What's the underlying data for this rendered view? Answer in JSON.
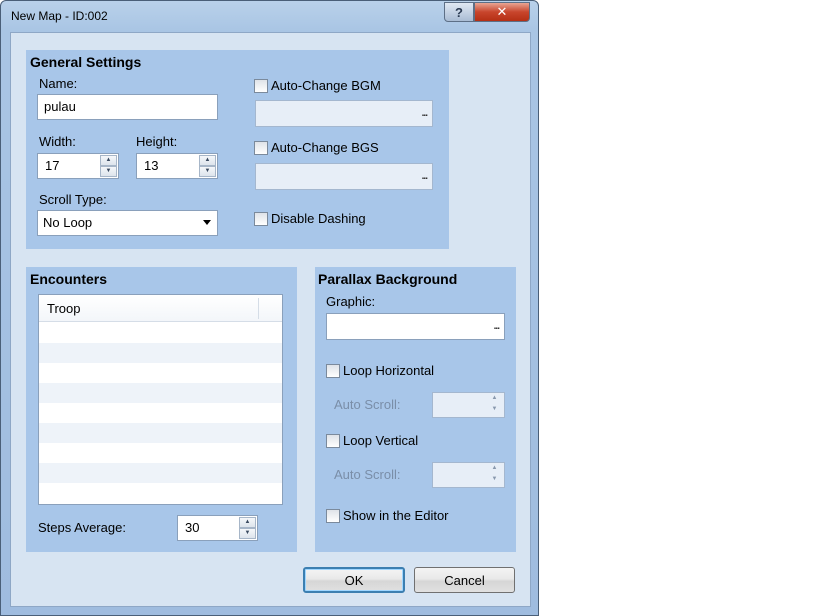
{
  "window": {
    "title": "New Map - ID:002",
    "help_glyph": "?",
    "close_glyph": "✕"
  },
  "general": {
    "title": "General Settings",
    "name_label": "Name:",
    "name_value": "pulau",
    "width_label": "Width:",
    "width_value": "17",
    "height_label": "Height:",
    "height_value": "13",
    "scroll_label": "Scroll Type:",
    "scroll_value": "No Loop",
    "bgm_label": "Auto-Change BGM",
    "bgs_label": "Auto-Change BGS",
    "dash_label": "Disable Dashing",
    "ellipsis": "..."
  },
  "encounters": {
    "title": "Encounters",
    "column": "Troop",
    "steps_label": "Steps Average:",
    "steps_value": "30"
  },
  "parallax": {
    "title": "Parallax Background",
    "graphic_label": "Graphic:",
    "ellipsis": "...",
    "loop_h_label": "Loop Horizontal",
    "auto_scroll_label_1": "Auto Scroll:",
    "loop_v_label": "Loop Vertical",
    "auto_scroll_label_2": "Auto Scroll:",
    "show_editor_label": "Show in the Editor"
  },
  "buttons": {
    "ok": "OK",
    "cancel": "Cancel"
  },
  "icons": {
    "spin_up": "up-arrow-icon",
    "spin_down": "down-arrow-icon",
    "combo": "chevron-down-icon"
  }
}
